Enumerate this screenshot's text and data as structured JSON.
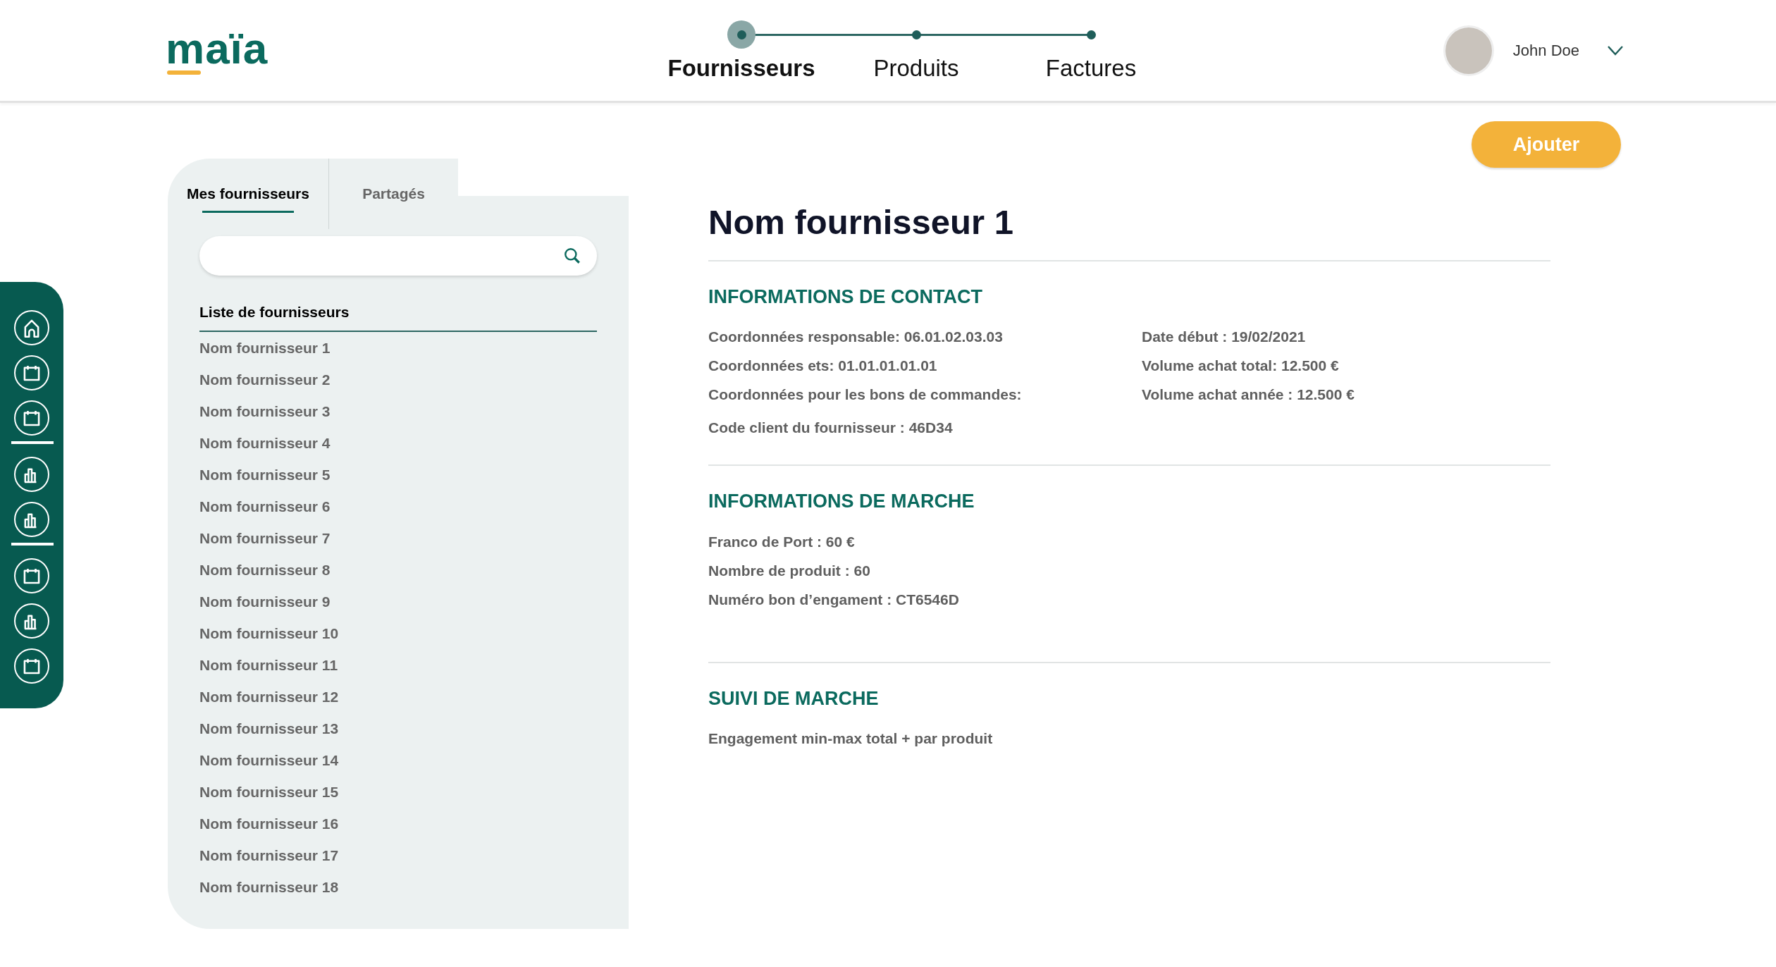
{
  "logo": {
    "text": "maïa"
  },
  "stepper": [
    {
      "label": "Fournisseurs",
      "selected": true
    },
    {
      "label": "Produits",
      "selected": false
    },
    {
      "label": "Factures",
      "selected": false
    }
  ],
  "user": {
    "name": "John Doe"
  },
  "sidebar": {
    "groups": [
      [
        {
          "kind": "home"
        },
        {
          "kind": "calendar"
        },
        {
          "kind": "calendar"
        }
      ],
      [
        {
          "kind": "chart"
        },
        {
          "kind": "chart"
        }
      ],
      [
        {
          "kind": "calendar"
        },
        {
          "kind": "chart"
        },
        {
          "kind": "calendar"
        }
      ]
    ]
  },
  "tabs": [
    {
      "label": "Mes fournisseurs",
      "selected": true
    },
    {
      "label": "Partagés",
      "selected": false
    }
  ],
  "list": {
    "title": "Liste de fournisseurs",
    "items": [
      "Nom fournisseur 1",
      "Nom fournisseur 2",
      "Nom fournisseur 3",
      "Nom fournisseur 4",
      "Nom fournisseur 5",
      "Nom fournisseur 6",
      "Nom fournisseur 7",
      "Nom fournisseur 8",
      "Nom fournisseur 9",
      "Nom fournisseur 10",
      "Nom fournisseur 11",
      "Nom fournisseur 12",
      "Nom fournisseur 13",
      "Nom fournisseur 14",
      "Nom fournisseur 15",
      "Nom fournisseur 16",
      "Nom fournisseur 17",
      "Nom fournisseur 18"
    ]
  },
  "add_button": "Ajouter",
  "detail": {
    "title": "Nom fournisseur 1",
    "sections": [
      {
        "heading": "INFORMATIONS DE CONTACT",
        "columns": [
          [
            "Coordonnées responsable: 06.01.02.03.03",
            "Coordonnées ets: 01.01.01.01.01",
            "Coordonnées pour les bons de commandes:"
          ],
          [
            "Date début : 19/02/2021",
            "Volume achat total: 12.500 €",
            "Volume achat année : 12.500 €"
          ]
        ],
        "footer": "Code client du fournisseur : 46D34"
      },
      {
        "heading": "INFORMATIONS DE MARCHE",
        "columns": [
          [
            "Franco de Port : 60 €",
            "Nombre de produit : 60",
            "Numéro bon d’engament : CT6546D"
          ]
        ]
      },
      {
        "heading": "SUIVI DE MARCHE",
        "columns": [
          [
            "Engagement min-max total + par produit"
          ]
        ]
      }
    ]
  }
}
